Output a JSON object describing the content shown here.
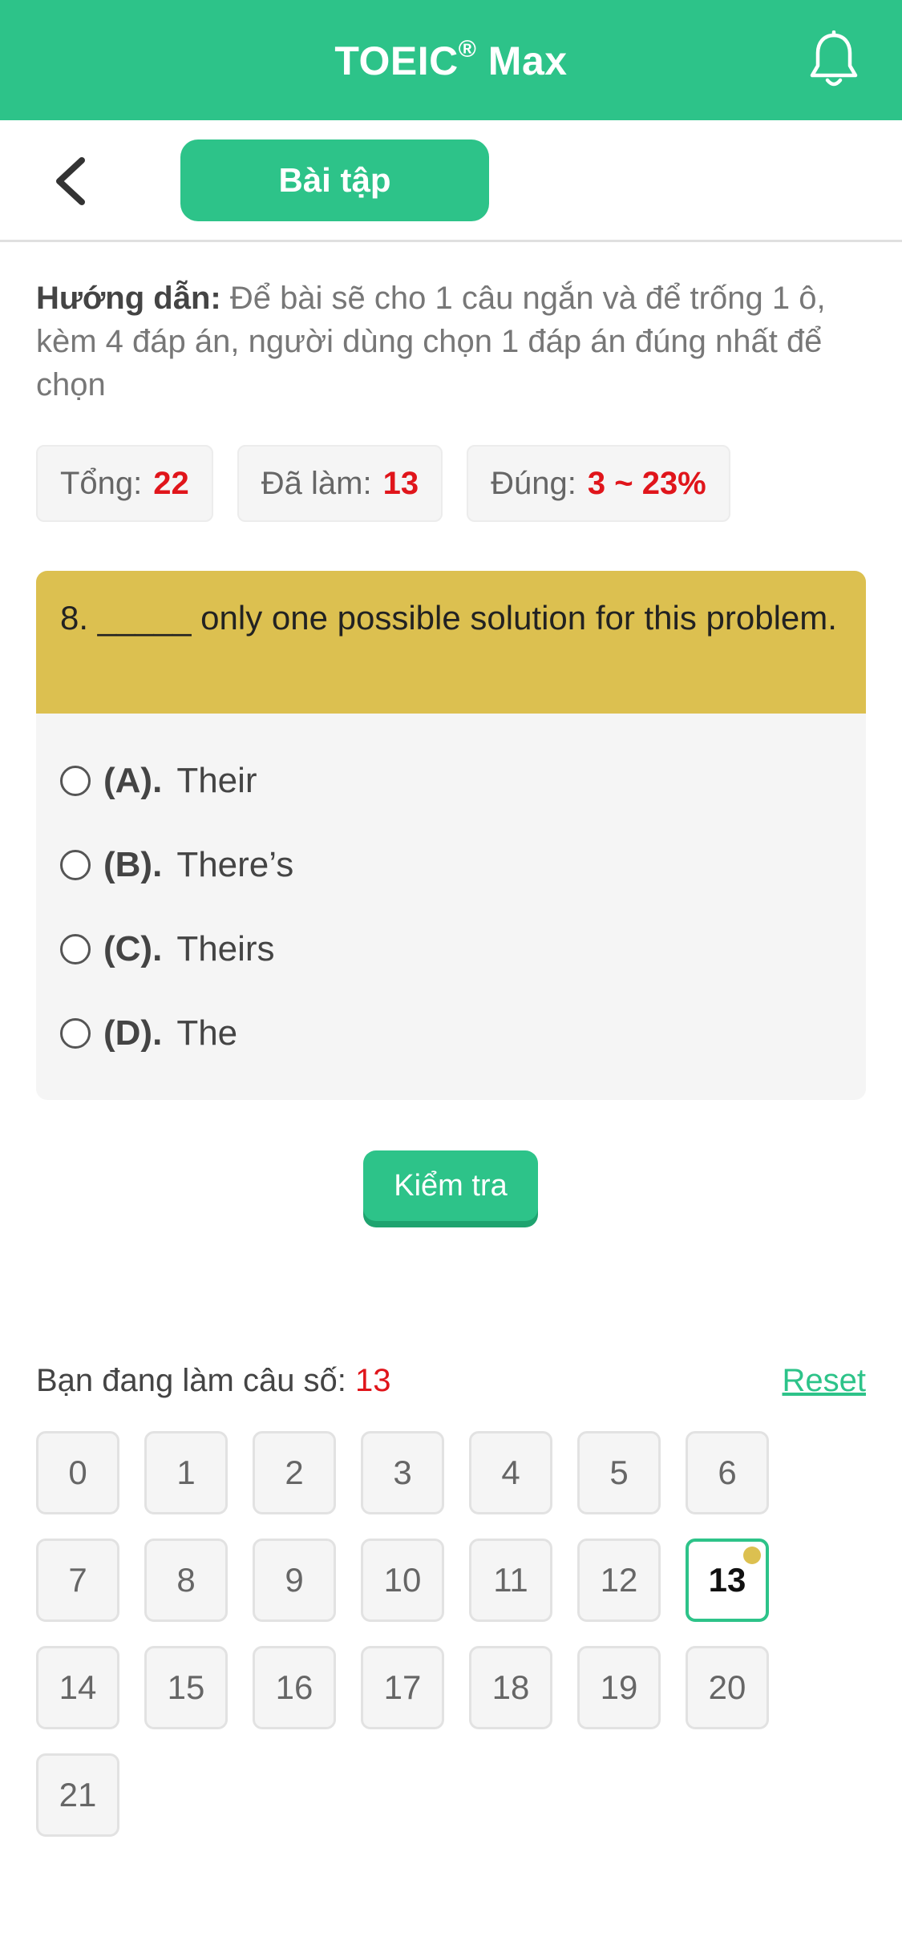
{
  "app": {
    "title": "TOEIC",
    "title_sup": "®",
    "title_rest": " Max"
  },
  "subbar": {
    "tab_label": "Bài tập"
  },
  "guide": {
    "label": "Hướng dẫn:",
    "text": " Để bài sẽ cho 1 câu ngắn và để trống 1 ô, kèm 4 đáp án, người dùng chọn 1 đáp án đúng nhất để chọn"
  },
  "stats": [
    {
      "label": "Tổng:",
      "value": "22"
    },
    {
      "label": "Đã làm:",
      "value": "13"
    },
    {
      "label": "Đúng:",
      "value": "3 ~ 23%"
    }
  ],
  "question": {
    "text": "8. _____ only one possible solution for this problem.",
    "options": [
      {
        "letter": "(A).",
        "text": "Their"
      },
      {
        "letter": "(B).",
        "text": "There’s"
      },
      {
        "letter": "(C).",
        "text": "Theirs"
      },
      {
        "letter": "(D).",
        "text": "The"
      }
    ]
  },
  "check_button": "Kiểm tra",
  "progress": {
    "label": "Bạn đang làm câu số:",
    "current": "13",
    "reset": "Reset",
    "numbers": [
      "0",
      "1",
      "2",
      "3",
      "4",
      "5",
      "6",
      "7",
      "8",
      "9",
      "10",
      "11",
      "12",
      "13",
      "14",
      "15",
      "16",
      "17",
      "18",
      "19",
      "20",
      "21"
    ],
    "active_index": 13
  },
  "colors": {
    "accent": "#2dc389",
    "question_header": "#dcc050",
    "highlight": "#e0151b"
  },
  "icons": {
    "bell": "bell-icon",
    "back": "chevron-left-icon"
  }
}
